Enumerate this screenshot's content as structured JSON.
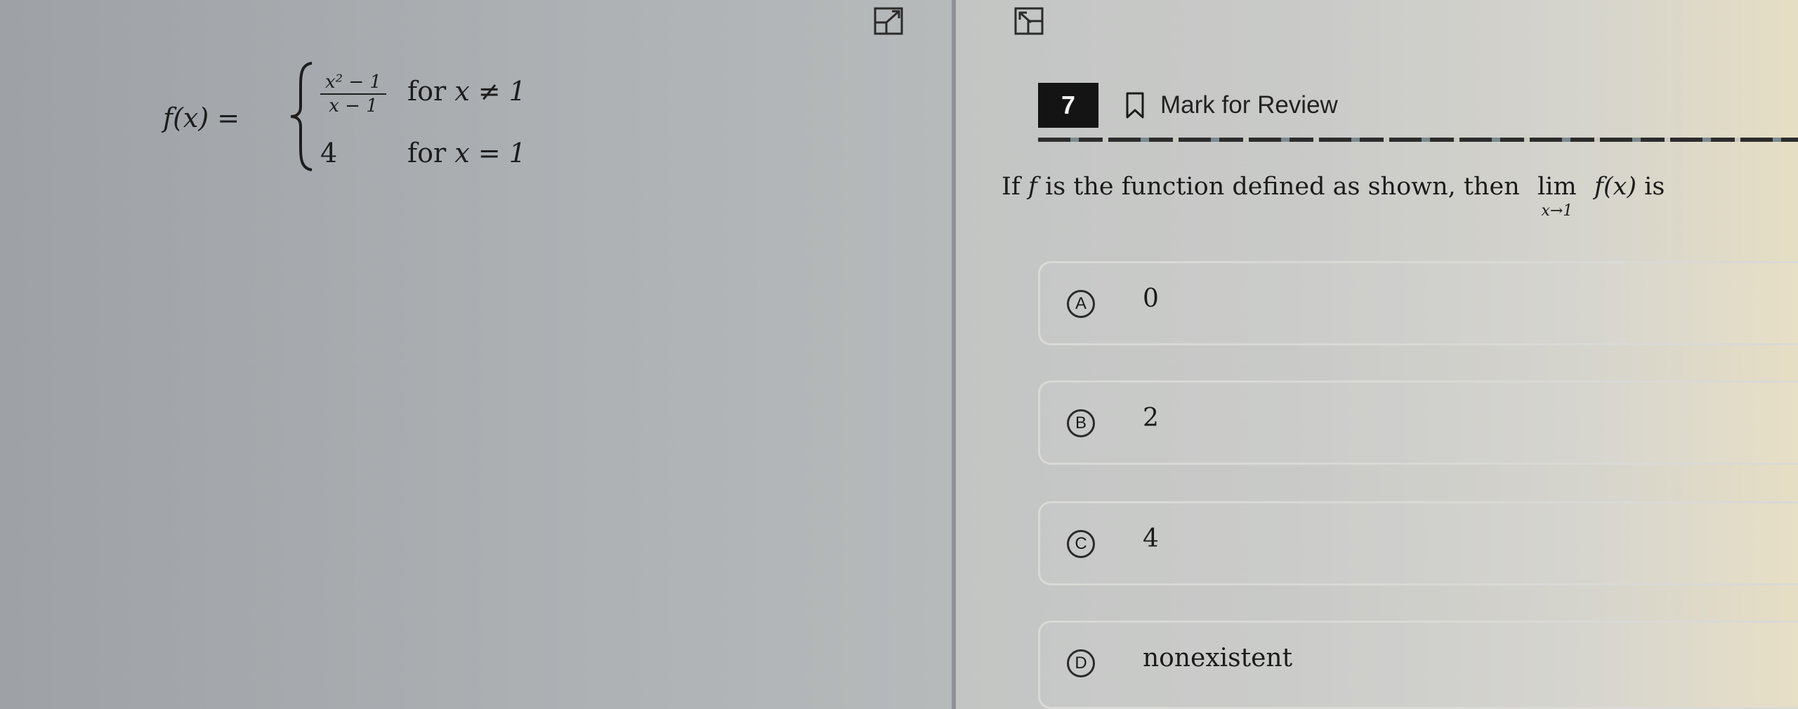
{
  "toolbar": {
    "left_toggle_icon": "expand-icon",
    "right_toggle_icon": "collapse-icon"
  },
  "function_definition": {
    "lhs": "f(x) =",
    "case1_numerator": "x² − 1",
    "case1_denominator": "x − 1",
    "case1_for": "for",
    "case1_condition": "x ≠ 1",
    "case2_value": "4",
    "case2_for": "for",
    "case2_condition": "x = 1"
  },
  "question": {
    "number": "7",
    "mark_for_review": "Mark for Review",
    "text_prefix": "If ",
    "text_f": "f",
    "text_middle": " is the function defined as shown, then ",
    "lim_word": "lim",
    "lim_sub": "x→1",
    "text_fx": " f(x)",
    "text_suffix": " is"
  },
  "choices": [
    {
      "letter": "A",
      "text": "0"
    },
    {
      "letter": "B",
      "text": "2"
    },
    {
      "letter": "C",
      "text": "4"
    },
    {
      "letter": "D",
      "text": "nonexistent"
    }
  ],
  "colors": {
    "question_number_bg": "#141414",
    "question_number_text": "#f2f2f2",
    "choice_border": "#d9d9d6"
  }
}
